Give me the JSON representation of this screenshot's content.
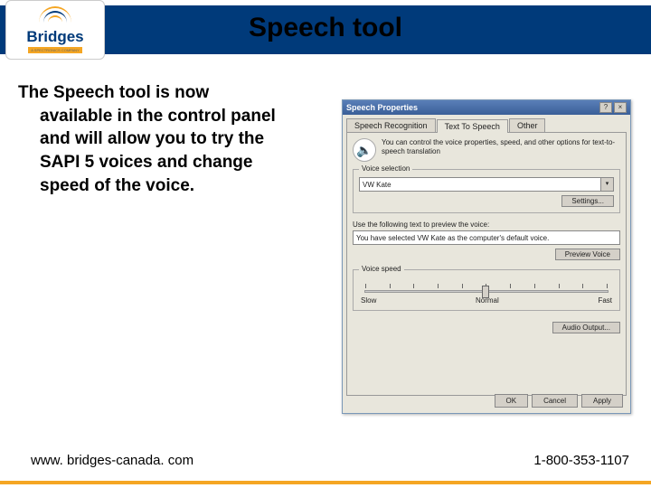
{
  "header": {
    "title": "Speech tool"
  },
  "logo": {
    "text": "Bridges",
    "sub": "A SPECTRONICS COMPANY"
  },
  "body": {
    "line1": "The Speech tool is now",
    "rest": "available in the control panel and will allow you to try the SAPI 5 voices and change speed of the voice."
  },
  "footer": {
    "url": "www. bridges-canada. com",
    "phone": "1-800-353-1107"
  },
  "window": {
    "title": "Speech Properties",
    "help": "?",
    "close": "×",
    "tabs": {
      "sr": "Speech Recognition",
      "tts": "Text To Speech",
      "other": "Other"
    },
    "desc": "You can control the voice properties, speed, and other options for text-to-speech translation",
    "voice_group": "Voice selection",
    "voice_value": "VW Kate",
    "settings_btn": "Settings...",
    "preview_label": "Use the following text to preview the voice:",
    "preview_text": "You have selected VW Kate as the computer's default voice.",
    "preview_btn": "Preview Voice",
    "speed_group": "Voice speed",
    "speed": {
      "slow": "Slow",
      "normal": "Normal",
      "fast": "Fast"
    },
    "audio_btn": "Audio Output...",
    "ok": "OK",
    "cancel": "Cancel",
    "apply": "Apply"
  }
}
